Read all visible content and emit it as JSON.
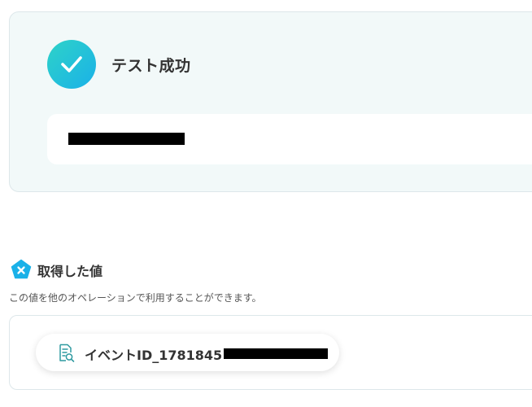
{
  "test_result": {
    "status_label": "テスト成功",
    "icon": "checkmark-icon",
    "accent_gradient": [
      "#2ed3c8",
      "#1ab1e8"
    ]
  },
  "retrieved_values": {
    "title": "取得した値",
    "description": "この値を他のオペレーションで利用することができます。",
    "section_icon": "pentagon-x-icon",
    "items": [
      {
        "label": "イベントID_1781845",
        "icon": "document-search-icon"
      }
    ]
  },
  "colors": {
    "card_background": "#f2f9f9",
    "border": "#dde7ea",
    "section_icon": "#1ab1e8",
    "text": "#333333"
  }
}
